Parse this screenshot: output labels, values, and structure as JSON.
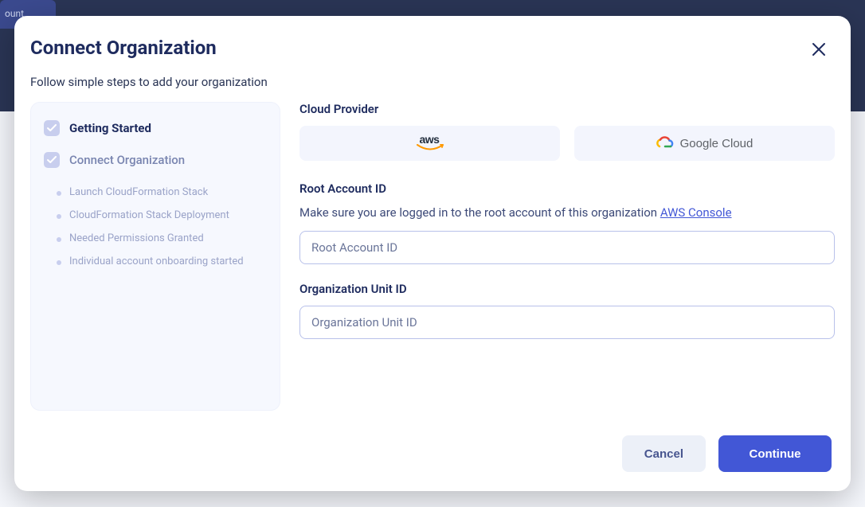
{
  "bg": {
    "tab_fragment": "ount"
  },
  "modal": {
    "title": "Connect Organization",
    "subtitle": "Follow  simple steps to add your organization",
    "close_aria": "Close"
  },
  "colors": {
    "primary": "#4257d6",
    "card_bg": "#f6f8fe"
  },
  "sidebar": {
    "steps": [
      {
        "label": "Getting Started",
        "active": true
      },
      {
        "label": "Connect Organization",
        "active": false
      }
    ],
    "sub_steps": [
      "Launch CloudFormation Stack",
      "CloudFormation Stack Deployment",
      "Needed Permissions Granted",
      "Individual account onboarding started"
    ]
  },
  "form": {
    "cloud_provider_label": "Cloud Provider",
    "providers": {
      "aws": "aws",
      "gcloud": "Google Cloud"
    },
    "root_account": {
      "label": "Root Account ID",
      "help": "Make sure you are logged in to the root account of this organization ",
      "link": "AWS Console",
      "placeholder": "Root Account ID",
      "value": ""
    },
    "org_unit": {
      "label": "Organization Unit ID",
      "placeholder": "Organization Unit ID",
      "value": ""
    }
  },
  "footer": {
    "cancel": "Cancel",
    "continue": "Continue"
  }
}
